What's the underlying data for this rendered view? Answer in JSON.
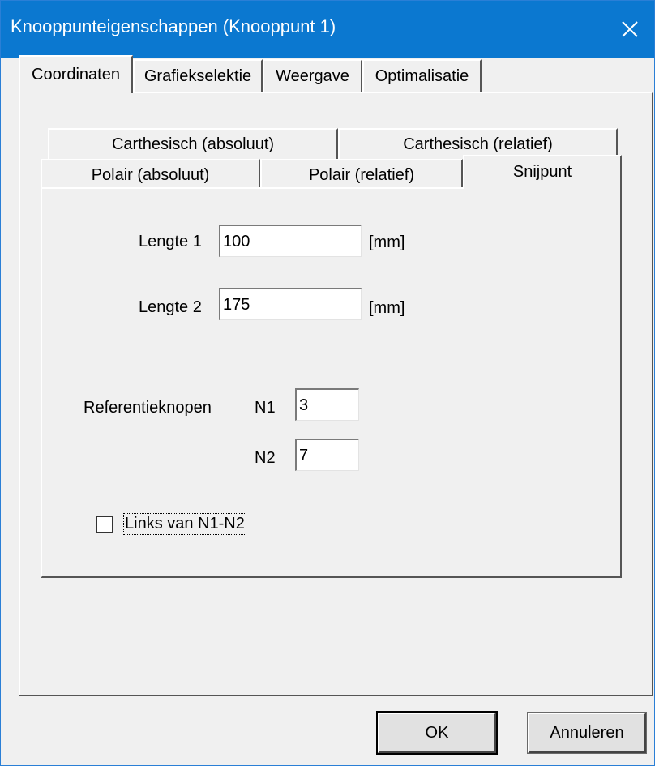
{
  "window": {
    "title": "Knooppunteigenschappen (Knooppunt 1)"
  },
  "outer_tabs": [
    {
      "label": "Coordinaten",
      "active": true
    },
    {
      "label": "Grafiekselektie",
      "active": false
    },
    {
      "label": "Weergave",
      "active": false
    },
    {
      "label": "Optimalisatie",
      "active": false
    }
  ],
  "inner_tabs": {
    "row1": [
      {
        "label": "Carthesisch (absoluut)"
      },
      {
        "label": "Carthesisch (relatief)"
      }
    ],
    "row2": [
      {
        "label": "Polair (absoluut)"
      },
      {
        "label": "Polair (relatief)"
      },
      {
        "label": "Snijpunt",
        "active": true
      }
    ]
  },
  "snijpunt": {
    "lengte1_label": "Lengte 1",
    "lengte1_value": "100",
    "lengte1_unit": "[mm]",
    "lengte2_label": "Lengte 2",
    "lengte2_value": "175",
    "lengte2_unit": "[mm]",
    "referentieknopen_label": "Referentieknopen",
    "n1_label": "N1",
    "n1_value": "3",
    "n2_label": "N2",
    "n2_value": "7",
    "links_label": "Links van N1-N2",
    "links_checked": false
  },
  "buttons": {
    "ok": "OK",
    "cancel": "Annuleren"
  },
  "colors": {
    "titlebar": "#0b78d0",
    "face": "#f0f0f0"
  }
}
